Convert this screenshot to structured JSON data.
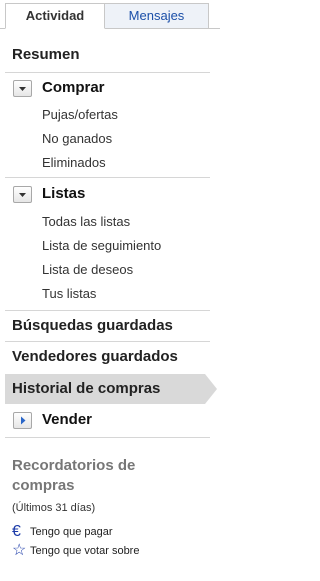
{
  "tabs": {
    "active": "Actividad",
    "inactive": "Mensajes"
  },
  "summary": "Resumen",
  "buy": {
    "label": "Comprar",
    "items": [
      "Pujas/ofertas",
      "No ganados",
      "Eliminados"
    ]
  },
  "lists": {
    "label": "Listas",
    "items": [
      "Todas las listas",
      "Lista de seguimiento",
      "Lista de deseos",
      "Tus listas"
    ]
  },
  "saved_searches": "Búsquedas guardadas",
  "saved_sellers": "Vendedores guardados",
  "purchase_history": "Historial de compras",
  "sell": {
    "label": "Vender"
  },
  "reminders": {
    "title": "Recordatorios de compras",
    "note": "(Últimos 31 días)",
    "items": [
      {
        "icon": "euro-icon",
        "text": "Tengo que pagar"
      },
      {
        "icon": "star-outline-icon",
        "text": "Tengo que votar sobre"
      }
    ]
  },
  "colors": {
    "link": "#1b4fa8",
    "highlight": "#d9d9d9",
    "icon": "#1b3aa8"
  }
}
